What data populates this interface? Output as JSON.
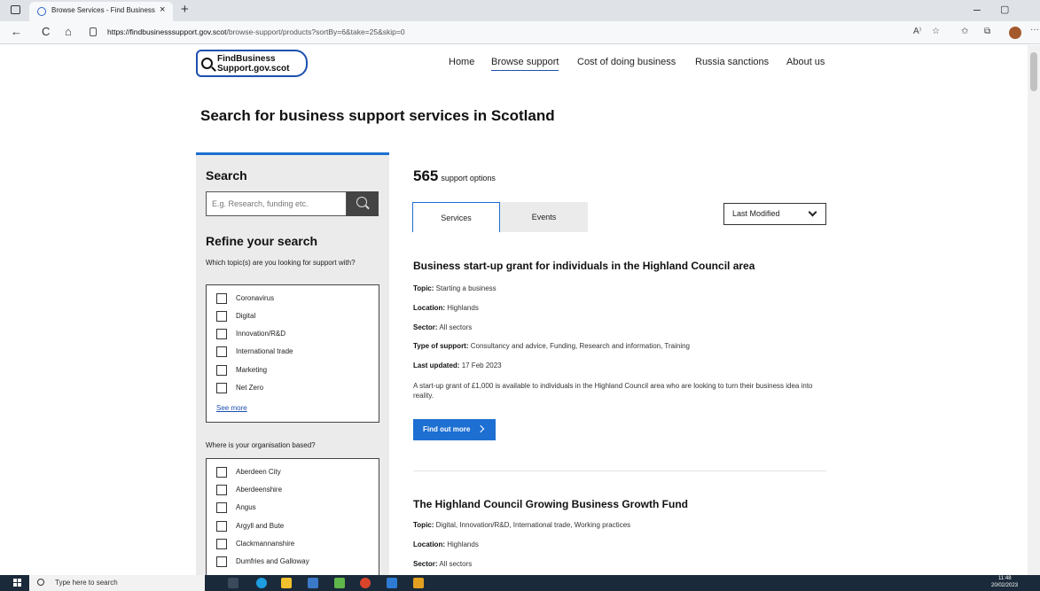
{
  "browser": {
    "tab_title": "Browse Services - Find Business S",
    "tab_close": "×",
    "new_tab": "+",
    "url_host": "https://findbusinesssupport.gov.scot",
    "url_path": "/browse-support/products?sortBy=6&take=25&skip=0",
    "back": "←",
    "reload": "C",
    "home": "⌂",
    "minimize": "–",
    "restore": "▢",
    "more": "···",
    "read_aloud": "A⁾",
    "favorites_add": "☆",
    "favorites": "✩",
    "collections": "⧉"
  },
  "header": {
    "logo_line1": "FindBusiness",
    "logo_line2": "Support.gov.scot",
    "nav": [
      "Home",
      "Browse support",
      "Cost of doing business",
      "Russia sanctions",
      "About us"
    ]
  },
  "page_title": "Search for business support services in Scotland",
  "sidebar": {
    "search_heading": "Search",
    "search_placeholder": "E.g. Research, funding etc.",
    "refine_heading": "Refine your search",
    "topic_question": "Which topic(s) are you looking for support with?",
    "topics": [
      "Coronavirus",
      "Digital",
      "Innovation/R&D",
      "International trade",
      "Marketing",
      "Net Zero"
    ],
    "see_more": "See more",
    "location_question": "Where is your organisation based?",
    "locations": [
      "Aberdeen City",
      "Aberdeenshire",
      "Angus",
      "Argyll and Bute",
      "Clackmannanshire",
      "Dumfries and Galloway"
    ]
  },
  "results": {
    "count": "565",
    "count_label": "support options",
    "tabs": [
      "Services",
      "Events"
    ],
    "sort_selected": "Last Modified",
    "items": [
      {
        "title": "Business start-up grant for individuals in the Highland Council area",
        "topic_label": "Topic:",
        "topic": "Starting a business",
        "location_label": "Location:",
        "location": "Highlands",
        "sector_label": "Sector:",
        "sector": "All sectors",
        "type_label": "Type of support:",
        "type": "Consultancy and advice, Funding, Research and information, Training",
        "updated_label": "Last updated:",
        "updated": "17 Feb 2023",
        "description": "A start-up grant of £1,000 is available to individuals in the Highland Council area who are looking to turn their business idea into reality.",
        "button": "Find out more"
      },
      {
        "title": "The Highland Council Growing Business Growth Fund",
        "topic_label": "Topic:",
        "topic": "Digital, Innovation/R&D, International trade, Working practices",
        "location_label": "Location:",
        "location": "Highlands",
        "sector_label": "Sector:",
        "sector": "All sectors"
      }
    ]
  },
  "taskbar": {
    "search_placeholder": "Type here to search",
    "time": "11:48",
    "date": "20/02/2023"
  }
}
